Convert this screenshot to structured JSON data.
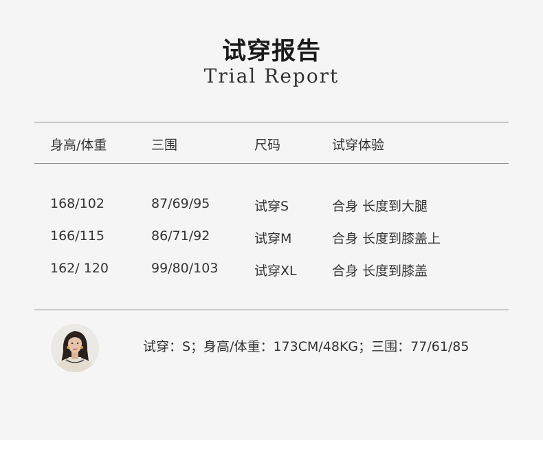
{
  "title": {
    "cn": "试穿报告",
    "en": "Trial Report"
  },
  "table": {
    "headers": [
      "身高/体重",
      "三围",
      "尺码",
      "试穿体验"
    ],
    "rows": [
      [
        "168/102",
        "87/69/95",
        "试穿S",
        "合身 长度到大腿"
      ],
      [
        "166/115",
        "86/71/92",
        "试穿M",
        "合身 长度到膝盖上"
      ],
      [
        "162/ 120",
        "99/80/103",
        "试穿XL",
        "合身 长度到膝盖"
      ]
    ]
  },
  "model": {
    "info": "试穿：S；身高/体重：173CM/48KG；三围：77/61/85"
  }
}
